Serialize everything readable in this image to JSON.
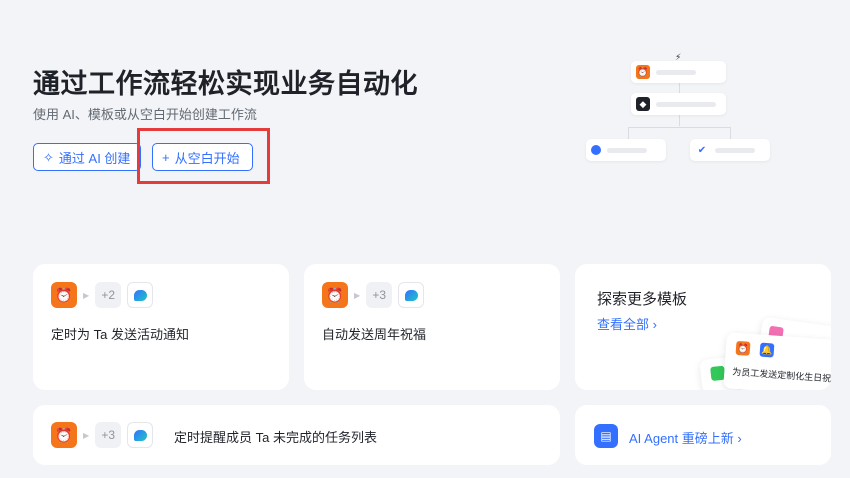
{
  "hero": {
    "title": "通过工作流轻松实现业务自动化",
    "subtitle": "使用 AI、模板或从空白开始创建工作流",
    "ai_button": "通过 AI 创建",
    "blank_button": "从空白开始"
  },
  "templates": [
    {
      "plus_count": "+2",
      "title": "定时为 Ta 发送活动通知"
    },
    {
      "plus_count": "+3",
      "title": "自动发送周年祝福"
    },
    {
      "plus_count": "+3",
      "title": "定时提醒成员 Ta 未完成的任务列表"
    }
  ],
  "explore": {
    "title": "探索更多模板",
    "link": "查看全部 ›",
    "preview_text": "为员工发送定制化生日祝福"
  },
  "agent": {
    "link": "AI Agent 重磅上新 ›"
  },
  "colors": {
    "accent": "#3370ff",
    "alarm": "#f5761a",
    "highlight": "#e63b3b"
  }
}
